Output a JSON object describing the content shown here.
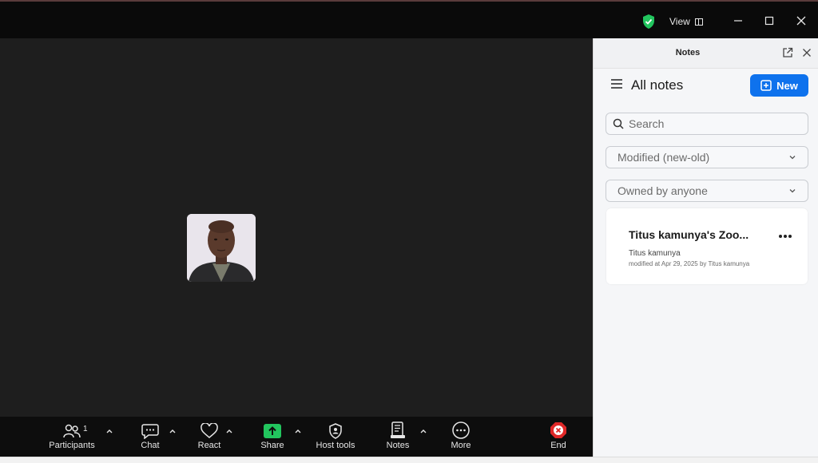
{
  "titlebar": {
    "view_label": "View",
    "icons": [
      "shield-check-icon",
      "grid-icon",
      "minimize-icon",
      "maximize-icon",
      "close-icon"
    ],
    "shield_color": "#22c55e"
  },
  "toolbar": {
    "participants_label": "Participants",
    "participants_count": "1",
    "chat_label": "Chat",
    "react_label": "React",
    "share_label": "Share",
    "host_tools_label": "Host tools",
    "notes_label": "Notes",
    "more_label": "More",
    "end_label": "End",
    "share_color": "#22c55e",
    "end_color": "#e02828"
  },
  "notes_panel": {
    "title": "Notes",
    "heading": "All notes",
    "new_button": "New",
    "search_placeholder": "Search",
    "sort_select": "Modified (new-old)",
    "owner_select": "Owned by anyone",
    "accent_color": "#0e72ed",
    "notes": [
      {
        "title": "Titus kamunya's Zoo...",
        "owner": "Titus kamunya",
        "modified": "modified at Apr 29, 2025 by Titus kamunya"
      }
    ]
  }
}
